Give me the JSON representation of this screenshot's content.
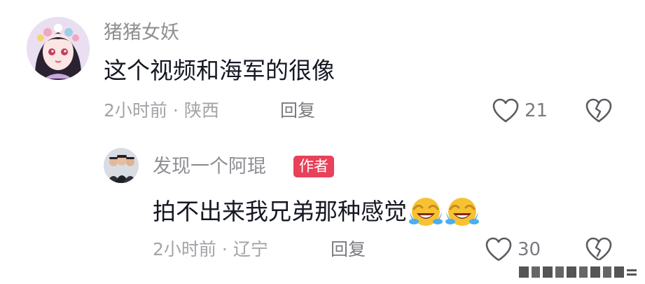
{
  "comments": [
    {
      "username": "猪猪女妖",
      "text": "这个视频和海军的很像",
      "time": "2小时前",
      "separator": "·",
      "location": "陕西",
      "reply_label": "回复",
      "likes": "21",
      "avatar": "anime-girl-avatar"
    }
  ],
  "reply": {
    "username": "发现一个阿琨",
    "badge": "作者",
    "text": "拍不出来我兄弟那种感觉",
    "emojis": [
      "laughing-crying-emoji",
      "laughing-crying-emoji"
    ],
    "time": "2小时前",
    "separator": "·",
    "location": "辽宁",
    "reply_label": "回复",
    "likes": "30",
    "avatar": "group-photo-avatar"
  },
  "colors": {
    "badge": "#e8415a",
    "text": "#161823",
    "muted": "#a3a3a8",
    "username": "#8e8e93"
  }
}
